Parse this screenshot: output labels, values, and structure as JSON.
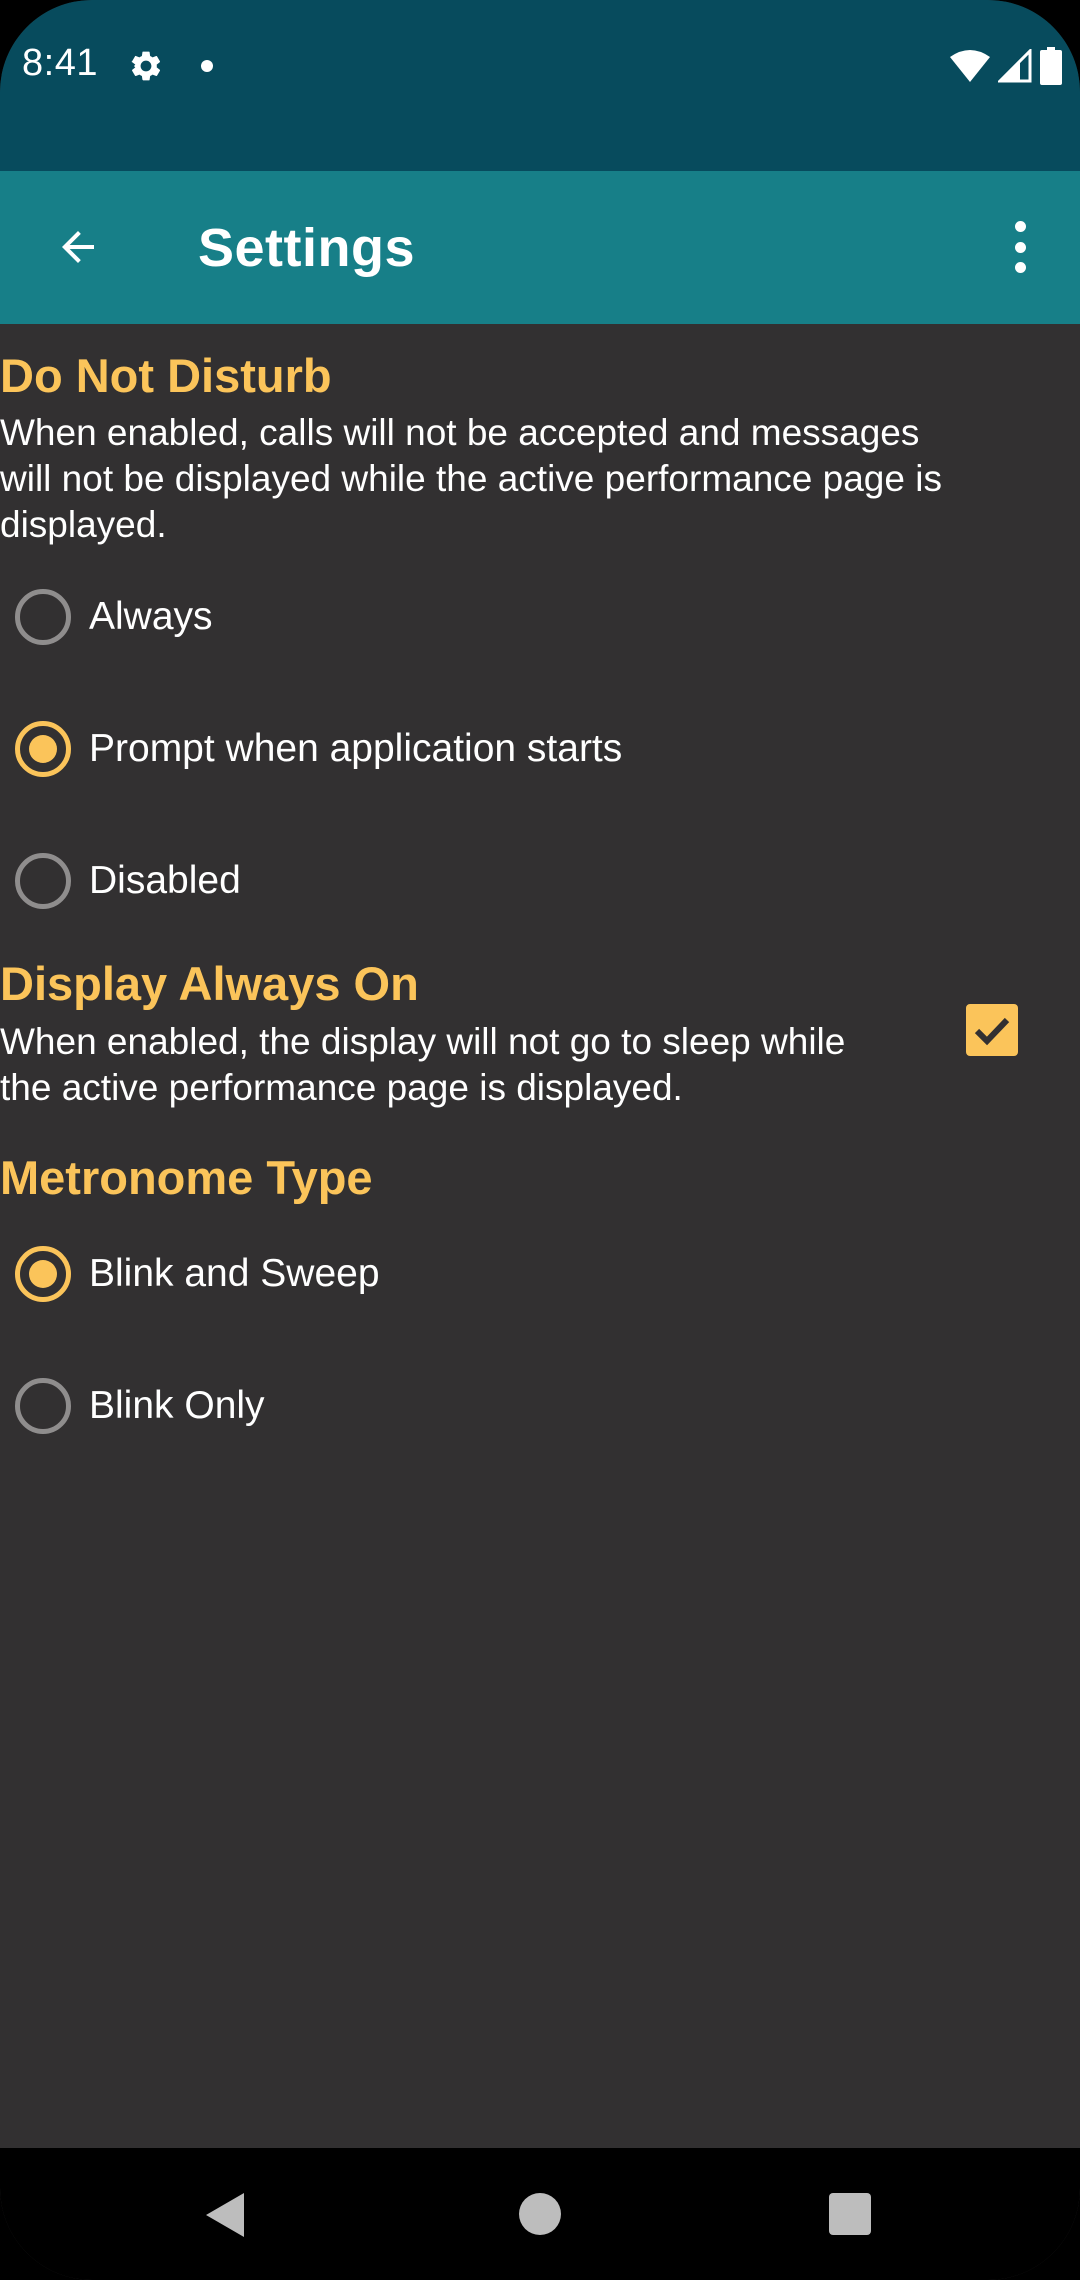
{
  "status_bar": {
    "time": "8:41",
    "icons": [
      "settings-icon",
      "notification-dot-icon",
      "wifi-icon",
      "signal-icon",
      "battery-icon"
    ]
  },
  "app_bar": {
    "title": "Settings",
    "back_icon": "arrow-back-icon",
    "menu_icon": "more-vert-icon"
  },
  "do_not_disturb": {
    "title": "Do Not Disturb",
    "description_lines": [
      "When enabled, calls will not be accepted and messages",
      "will not be displayed while the active performance page is",
      "displayed."
    ],
    "options": [
      {
        "label": "Always",
        "checked": false
      },
      {
        "label": "Prompt when application starts",
        "checked": true
      },
      {
        "label": "Disabled",
        "checked": false
      }
    ]
  },
  "display_always_on": {
    "title": "Display Always On",
    "description_lines": [
      "When enabled, the display will not go to sleep while",
      "the active performance page is displayed."
    ],
    "checked": true
  },
  "metronome_type": {
    "title": "Metronome Type",
    "options": [
      {
        "label": "Blink and Sweep",
        "checked": true
      },
      {
        "label": "Blink Only",
        "checked": false
      }
    ]
  },
  "colors": {
    "status_bar": "#074b5d",
    "app_bar": "#177f88",
    "background": "#323031",
    "accent": "#fbc45a",
    "radio_off": "#8f8d8d"
  },
  "nav_bar": {
    "icons": [
      "nav-back-icon",
      "nav-home-icon",
      "nav-recents-icon"
    ]
  }
}
